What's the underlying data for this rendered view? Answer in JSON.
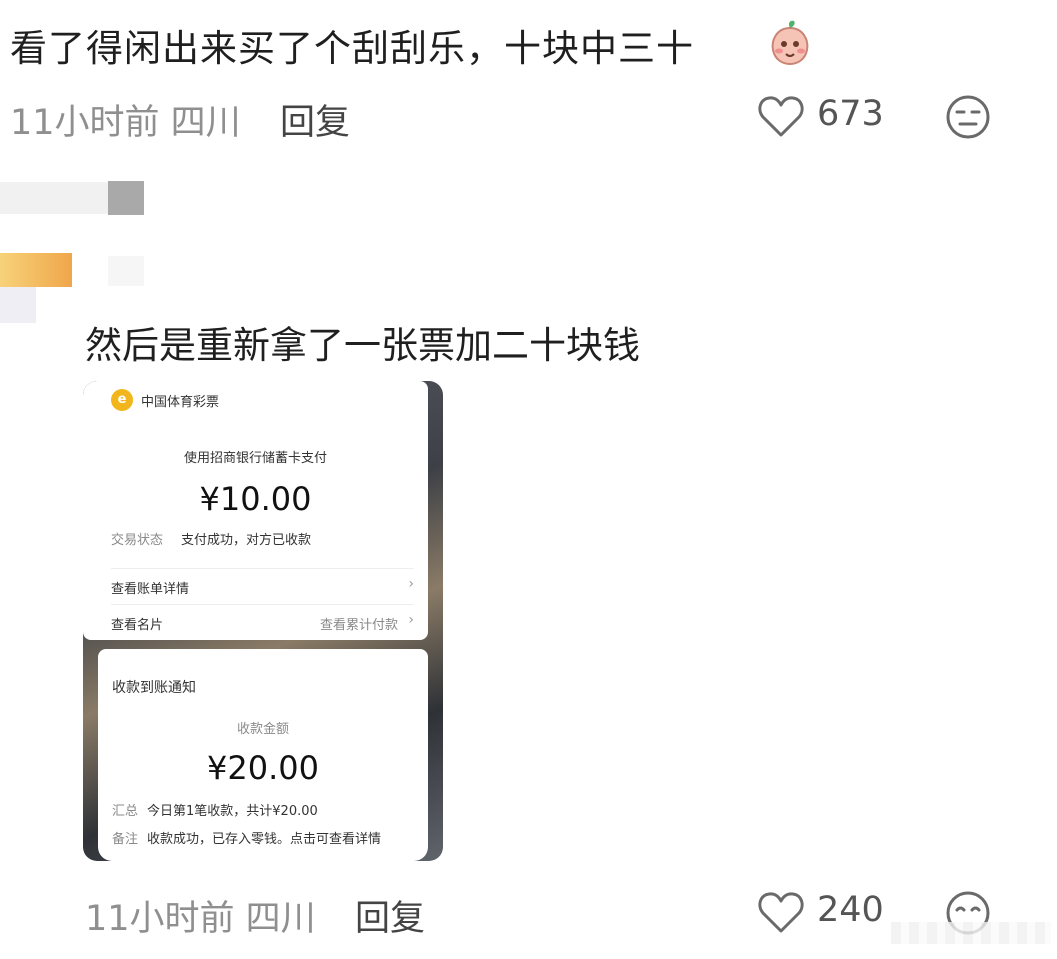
{
  "comment_main": {
    "text": "看了得闲出来买了个刮刮乐，十块中三十",
    "emoji": "peach-face-emoji",
    "time_location": "11小时前 四川",
    "reply_label": "回复",
    "like_count": "673"
  },
  "comment_reply": {
    "text": "然后是重新拿了一张票加二十块钱",
    "time_location": "11小时前 四川",
    "reply_label": "回复",
    "like_count": "240"
  },
  "screenshot": {
    "card1": {
      "merchant": "中国体育彩票",
      "pay_method": "使用招商银行储蓄卡支付",
      "amount": "¥10.00",
      "status_label": "交易状态",
      "status_value": "支付成功，对方已收款",
      "bill_detail": "查看账单详情",
      "view_card": "查看名片",
      "view_total": "查看累计付款"
    },
    "card2": {
      "title": "收款到账通知",
      "amount_label": "收款金额",
      "amount": "¥20.00",
      "summary_label": "汇总",
      "summary_value": "今日第1笔收款，共计¥20.00",
      "note_label": "备注",
      "note_value": "收款成功，已存入零钱。点击可查看详情"
    }
  },
  "colors": {
    "meta_grey": "#8f8f8f",
    "lottery_yellow": "#f2b51b"
  }
}
